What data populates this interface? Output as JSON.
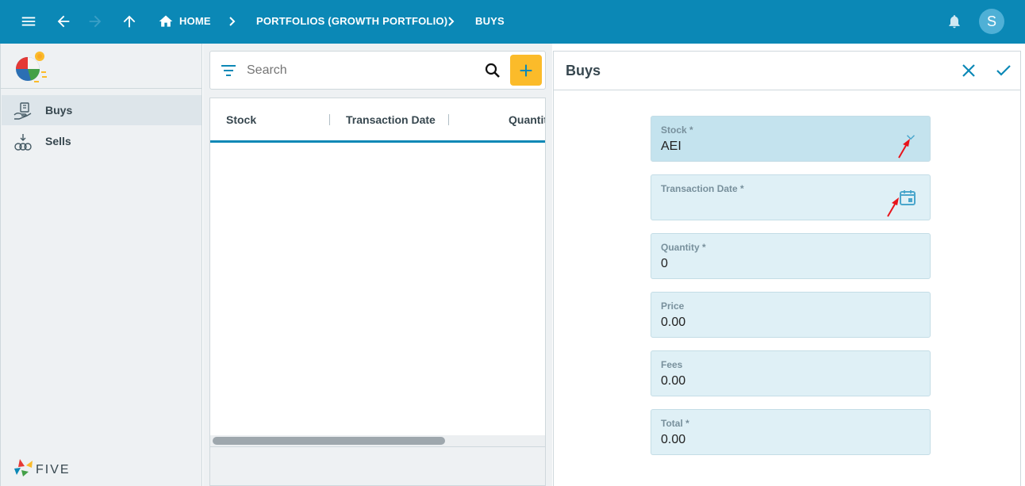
{
  "topbar": {
    "breadcrumbs": [
      "HOME",
      "PORTFOLIOS (GROWTH PORTFOLIO)",
      "BUYS"
    ],
    "avatar_initial": "S"
  },
  "sidebar": {
    "items": [
      {
        "label": "Buys",
        "icon": "buy-icon",
        "active": true
      },
      {
        "label": "Sells",
        "icon": "sell-icon",
        "active": false
      }
    ],
    "footer_logo_text": "FIVE"
  },
  "list": {
    "search_placeholder": "Search",
    "columns": [
      "Stock",
      "Transaction Date",
      "Quantit"
    ]
  },
  "form": {
    "title": "Buys",
    "fields": [
      {
        "label": "Stock *",
        "value": "AEI",
        "icon": "chevron-down-icon"
      },
      {
        "label": "Transaction Date *",
        "value": "",
        "icon": "calendar-icon"
      },
      {
        "label": "Quantity *",
        "value": "0"
      },
      {
        "label": "Price",
        "value": "0.00"
      },
      {
        "label": "Fees",
        "value": "0.00"
      },
      {
        "label": "Total *",
        "value": "0.00"
      }
    ]
  },
  "colors": {
    "primary": "#0b88b6",
    "accent": "#fbbb2a",
    "field_bg": "#dff0f6",
    "annotation_arrow": "#e8141b"
  }
}
